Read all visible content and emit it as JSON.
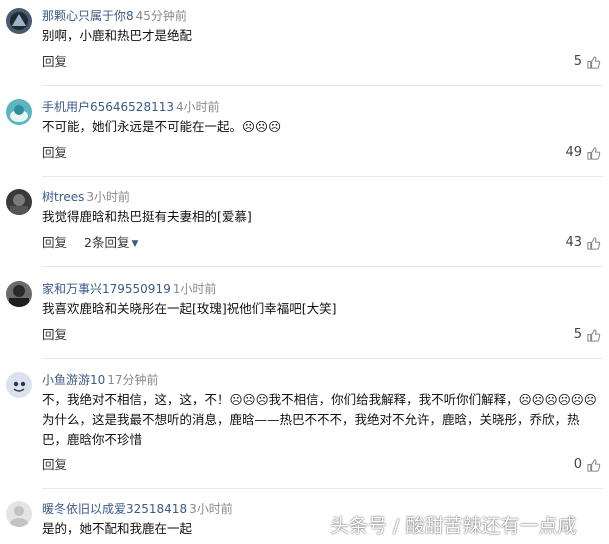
{
  "comments": [
    {
      "user": "那颗心只属于你8",
      "time": "45分钟前",
      "text": "别啊，小鹿和热巴才是绝配",
      "reply": "回复",
      "likes": "5"
    },
    {
      "user": "手机用户65646528113",
      "time": "4小时前",
      "text": "不可能，她们永远是不可能在一起。☹☹☹",
      "reply": "回复",
      "likes": "49"
    },
    {
      "user": "树trees",
      "time": "3小时前",
      "text": "我觉得鹿晗和热巴挺有夫妻相的[爱慕]",
      "reply": "回复",
      "sub": "2条回复",
      "likes": "43"
    },
    {
      "user": "家和万事兴179550919",
      "time": "1小时前",
      "text": "我喜欢鹿晗和关晓彤在一起[玫瑰]祝他们幸福吧[大笑]",
      "reply": "回复",
      "likes": "5"
    },
    {
      "user": "小鱼游游10",
      "time": "17分钟前",
      "text": "不，我绝对不相信，这，这，不！☹☹☹我不相信，你们给我解释，我不听你们解释，☹☹☹☹☹☹为什么，这是我最不想听的消息，鹿晗——热巴不不不，我绝对不允许，鹿晗，关晓彤，乔欣，热巴，鹿晗你不珍惜",
      "reply": "回复",
      "likes": "0"
    },
    {
      "user": "暖冬依旧以成爱32518418",
      "time": "3小时前",
      "text": "是的，她不配和我鹿在一起"
    }
  ],
  "watermark": "头条号 / 酸甜苦辣还有一点咸"
}
